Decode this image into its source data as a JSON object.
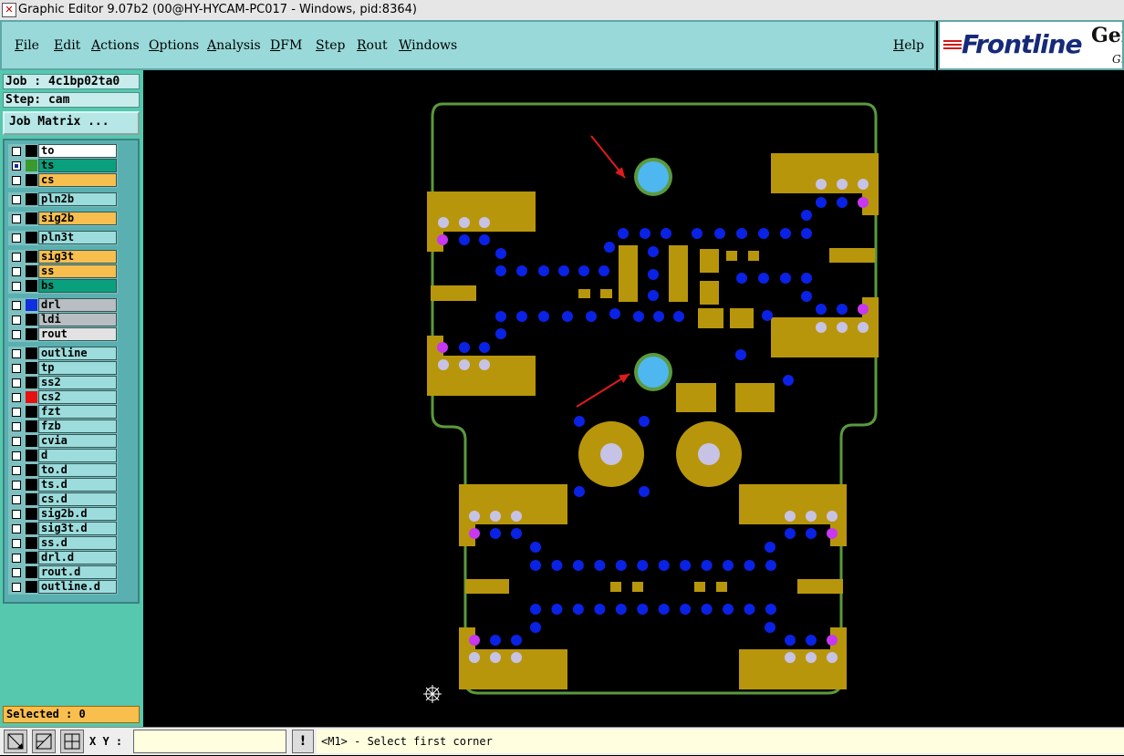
{
  "window": {
    "title": "Graphic Editor 9.07b2 (00@HY-HYCAM-PC017 - Windows, pid:8364)",
    "icon": "app-x-icon"
  },
  "menubar": {
    "items": [
      {
        "label": "File"
      },
      {
        "label": "Edit"
      },
      {
        "label": "Actions"
      },
      {
        "label": "Options"
      },
      {
        "label": "Analysis"
      },
      {
        "label": "DFM"
      },
      {
        "label": "Step"
      },
      {
        "label": "Rout"
      },
      {
        "label": "Windows"
      }
    ],
    "help": "Help"
  },
  "logo": {
    "brand": "Frontline",
    "side_top": "Gen",
    "side_bottom": "Gr"
  },
  "job": {
    "job_line": "Job : 4c1bp02ta0",
    "step_line": "Step: cam",
    "matrix_button": "Job Matrix ..."
  },
  "layers": [
    [
      {
        "name": "to",
        "color": "#ffffff",
        "swatch": "#000000",
        "checked": false
      },
      {
        "name": "ts",
        "color": "#0aa07e",
        "swatch": "#3a9a2e",
        "checked": true
      },
      {
        "name": "cs",
        "color": "#f8be4e",
        "swatch": "#000000",
        "checked": false
      }
    ],
    [
      {
        "name": "pln2b",
        "color": "#9cdcdc",
        "swatch": "#000000",
        "checked": false
      }
    ],
    [
      {
        "name": "sig2b",
        "color": "#f8be4e",
        "swatch": "#000000",
        "checked": false
      }
    ],
    [
      {
        "name": "pln3t",
        "color": "#9cdcdc",
        "swatch": "#000000",
        "checked": false
      }
    ],
    [
      {
        "name": "sig3t",
        "color": "#f8be4e",
        "swatch": "#000000",
        "checked": false
      },
      {
        "name": "ss",
        "color": "#f8be4e",
        "swatch": "#000000",
        "checked": false
      },
      {
        "name": "bs",
        "color": "#0aa07e",
        "swatch": "#000000",
        "checked": false
      }
    ],
    [
      {
        "name": "drl",
        "color": "#b8bec2",
        "swatch": "#1030e0",
        "checked": false
      },
      {
        "name": "ldi",
        "color": "#b8bec2",
        "swatch": "#000000",
        "checked": false
      },
      {
        "name": "rout",
        "color": "#e2e2e2",
        "swatch": "#000000",
        "checked": false
      }
    ],
    [
      {
        "name": "outline",
        "color": "#9cdcdc",
        "swatch": "#000000",
        "checked": false
      },
      {
        "name": "tp",
        "color": "#9cdcdc",
        "swatch": "#000000",
        "checked": false
      },
      {
        "name": "ss2",
        "color": "#9cdcdc",
        "swatch": "#000000",
        "checked": false
      },
      {
        "name": "cs2",
        "color": "#9cdcdc",
        "swatch": "#e81010",
        "checked": false
      },
      {
        "name": "fzt",
        "color": "#9cdcdc",
        "swatch": "#000000",
        "checked": false
      },
      {
        "name": "fzb",
        "color": "#9cdcdc",
        "swatch": "#000000",
        "checked": false
      },
      {
        "name": "cvia",
        "color": "#9cdcdc",
        "swatch": "#000000",
        "checked": false
      },
      {
        "name": "d",
        "color": "#9cdcdc",
        "swatch": "#000000",
        "checked": false
      },
      {
        "name": "to.d",
        "color": "#9cdcdc",
        "swatch": "#000000",
        "checked": false
      },
      {
        "name": "ts.d",
        "color": "#9cdcdc",
        "swatch": "#000000",
        "checked": false
      },
      {
        "name": "cs.d",
        "color": "#9cdcdc",
        "swatch": "#000000",
        "checked": false
      },
      {
        "name": "sig2b.d",
        "color": "#9cdcdc",
        "swatch": "#000000",
        "checked": false
      },
      {
        "name": "sig3t.d",
        "color": "#9cdcdc",
        "swatch": "#000000",
        "checked": false
      },
      {
        "name": "ss.d",
        "color": "#9cdcdc",
        "swatch": "#000000",
        "checked": false
      },
      {
        "name": "drl.d",
        "color": "#9cdcdc",
        "swatch": "#000000",
        "checked": false
      },
      {
        "name": "rout.d",
        "color": "#9cdcdc",
        "swatch": "#000000",
        "checked": false
      },
      {
        "name": "outline.d",
        "color": "#9cdcdc",
        "swatch": "#000000",
        "checked": false
      }
    ]
  ],
  "selected": "Selected : 0",
  "statusbar": {
    "xy_label": "X Y :",
    "xy_value": "",
    "warn": "!",
    "message": "<M1> - Select first corner"
  },
  "colors": {
    "menubar": "#99d9d9",
    "panel": "#55c8ad",
    "pad": "#b8960b",
    "via": "#0a22e6",
    "outline": "#5a9a3c",
    "hole": "#4fb7f0",
    "arrow": "#e01b1b",
    "board_hole": "#c7c3e6"
  }
}
